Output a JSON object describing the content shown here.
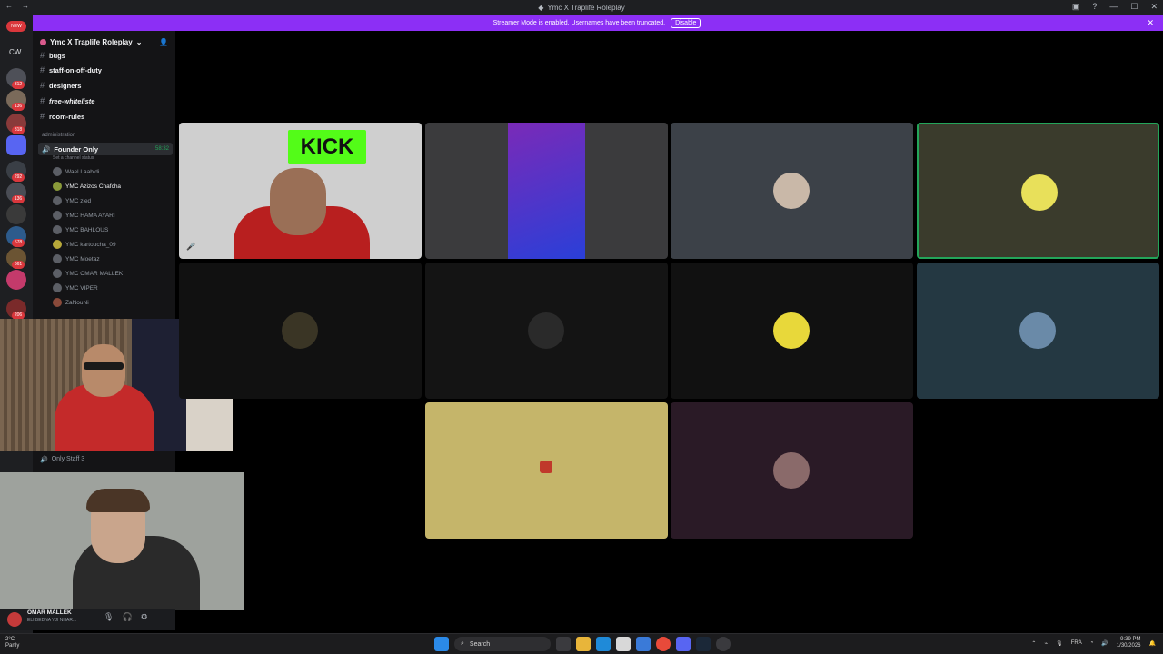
{
  "window": {
    "title": "Ymc X Traplife Roleplay"
  },
  "streamer_bar": {
    "message": "Streamer Mode is enabled. Usernames have been truncated.",
    "disable_label": "Disable",
    "close": "✕"
  },
  "server": {
    "name": "Ymc X Traplife Roleplay"
  },
  "rail": {
    "new_badge": "NEW",
    "cw_label": "CW"
  },
  "channels": [
    {
      "name": "bugs"
    },
    {
      "name": "staff-on-off-duty"
    },
    {
      "name": "designers"
    },
    {
      "name": "free-whiteliste"
    },
    {
      "name": "room-rules"
    }
  ],
  "category": "administration",
  "voice_channel": {
    "name": "Founder Only",
    "time": "58:32",
    "status": "Set a channel status"
  },
  "members": [
    {
      "name": "Wael Laabidi"
    },
    {
      "name": "YMC  Azizos Chafcha"
    },
    {
      "name": "YMC  zied"
    },
    {
      "name": "YMC  HAMA AYARI"
    },
    {
      "name": "YMC  BAHLOUS"
    },
    {
      "name": "YMC  kartoucha_09"
    },
    {
      "name": "YMC  Moetaz"
    },
    {
      "name": "YMC  OMAR MALLEK"
    },
    {
      "name": "YMC  VIPER"
    },
    {
      "name": "ZaNouNi"
    }
  ],
  "staff3": "Only Staff 3",
  "user": {
    "name": "OMAR MALLEK",
    "status": "ELI BEDNA YJI NHAR..."
  },
  "stream_tiles": [
    {
      "label": "KICK",
      "color": "#cfcfcf"
    },
    {
      "color": "#3b3b3d"
    },
    {
      "color": "#3c4148"
    },
    {
      "color": "#3a3b2c"
    },
    {
      "color": "#111111"
    },
    {
      "color": "#141414"
    },
    {
      "color": "#111111"
    },
    {
      "color": "#243842"
    },
    {
      "color": "#c5b56a"
    },
    {
      "color": "#2a1a26"
    }
  ],
  "taskbar": {
    "weather_temp": "2°C",
    "weather_desc": "Partly",
    "search_label": "Search",
    "lang": "FRA",
    "time": "9:39 PM",
    "date": "1/30/2026"
  }
}
